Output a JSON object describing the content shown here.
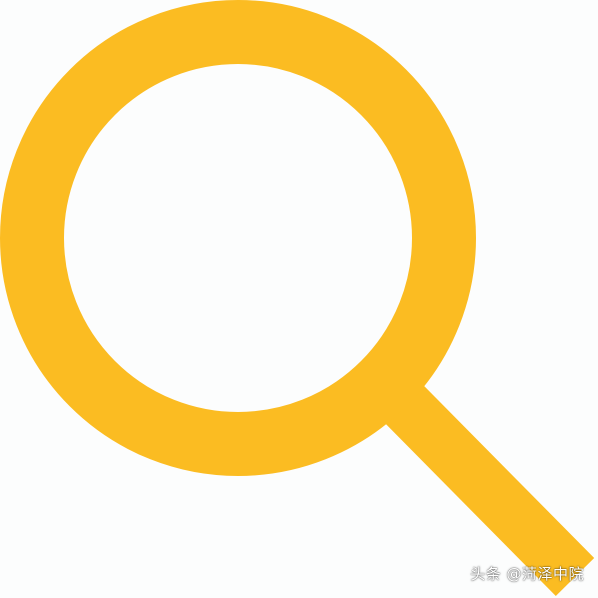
{
  "icon": {
    "name": "search-icon",
    "color": "#fbbc22"
  },
  "watermark": {
    "text": "头条 @菏泽中院"
  }
}
